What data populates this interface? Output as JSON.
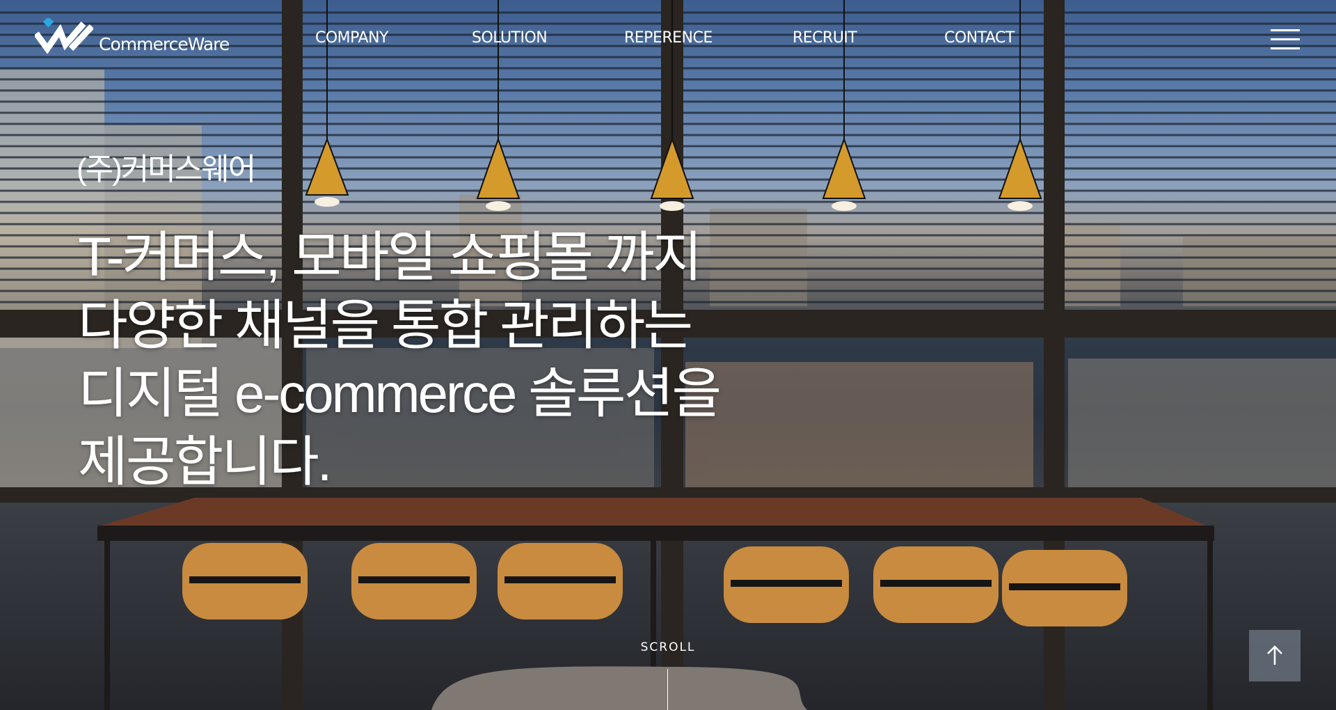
{
  "logo": {
    "name": "CommerceWare",
    "colors": {
      "mark": "#ffffff",
      "accent": "#2aa7e0"
    }
  },
  "nav": {
    "items": [
      {
        "label": "COMPANY"
      },
      {
        "label": "SOLUTION"
      },
      {
        "label": "REPERENCE"
      },
      {
        "label": "RECRUIT"
      },
      {
        "label": "CONTACT"
      }
    ],
    "menu_icon": "hamburger-menu-icon"
  },
  "hero": {
    "company_name": "(주)커머스웨어",
    "headline_lines": [
      "T-커머스, 모바일 쇼핑몰 까지",
      "다양한 채널을 통합 관리하는",
      "디지털 e-commerce 솔루션을",
      "제공합니다."
    ]
  },
  "scroll": {
    "label": "SCROLL"
  },
  "top_button": {
    "icon": "arrow-up-icon"
  },
  "colors": {
    "text": "#ffffff",
    "top_button_bg": "#6e7884"
  }
}
